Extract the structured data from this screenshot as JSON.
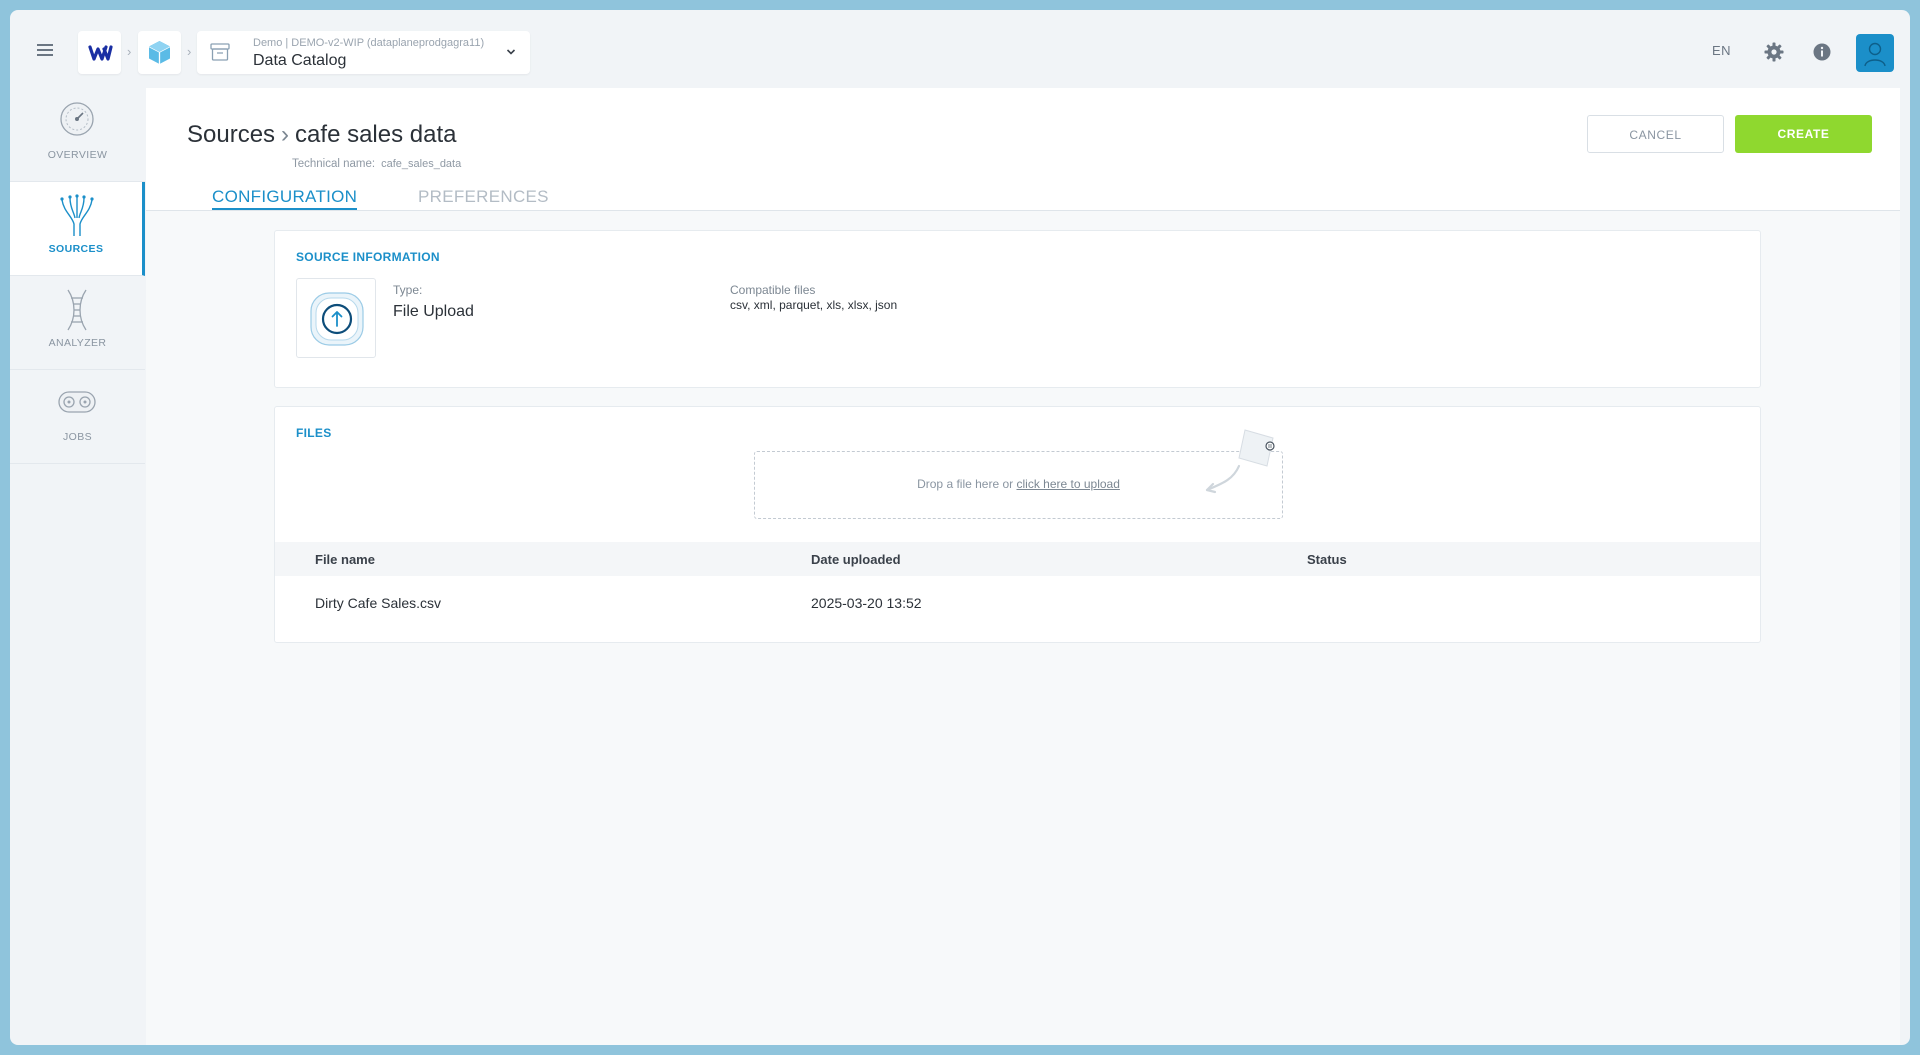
{
  "topbar": {
    "project_path": "Demo  |  DEMO-v2-WIP (dataplaneprodgagra11)",
    "app_name": "Data Catalog",
    "language": "EN",
    "icons": [
      "menu-icon",
      "logo-icon",
      "cube-icon",
      "archive-icon",
      "chevron-down-icon",
      "gear-icon",
      "info-icon",
      "avatar-icon"
    ]
  },
  "sidebar": {
    "items": [
      {
        "label": "OVERVIEW",
        "icon": "gauge-icon",
        "active": false
      },
      {
        "label": "SOURCES",
        "icon": "sources-icon",
        "active": true
      },
      {
        "label": "ANALYZER",
        "icon": "analyzer-icon",
        "active": false
      },
      {
        "label": "JOBS",
        "icon": "jobs-icon",
        "active": false
      }
    ]
  },
  "header": {
    "breadcrumb_root": "Sources",
    "breadcrumb_current": "cafe sales data",
    "technical_name_label": "Technical name:",
    "technical_name_value": "cafe_sales_data",
    "cancel_label": "CANCEL",
    "create_label": "CREATE",
    "tabs": [
      {
        "label": "CONFIGURATION",
        "active": true
      },
      {
        "label": "PREFERENCES",
        "active": false
      }
    ]
  },
  "source_info": {
    "title": "SOURCE INFORMATION",
    "type_label": "Type:",
    "type_value": "File Upload",
    "compatible_label": "Compatible files",
    "compatible_value": "csv, xml, parquet, xls, xlsx, json"
  },
  "files": {
    "title": "FILES",
    "drop_text": "Drop a file here  or ",
    "drop_link": "click here to upload",
    "columns": [
      "File name",
      "Date uploaded",
      "Status"
    ],
    "rows": [
      {
        "name": "Dirty Cafe Sales.csv",
        "date": "2025-03-20 13:52",
        "status": ""
      }
    ]
  },
  "colors": {
    "accent": "#1b8fc9",
    "create_button": "#8fd82f",
    "outer_frame": "#8fc4dc"
  }
}
